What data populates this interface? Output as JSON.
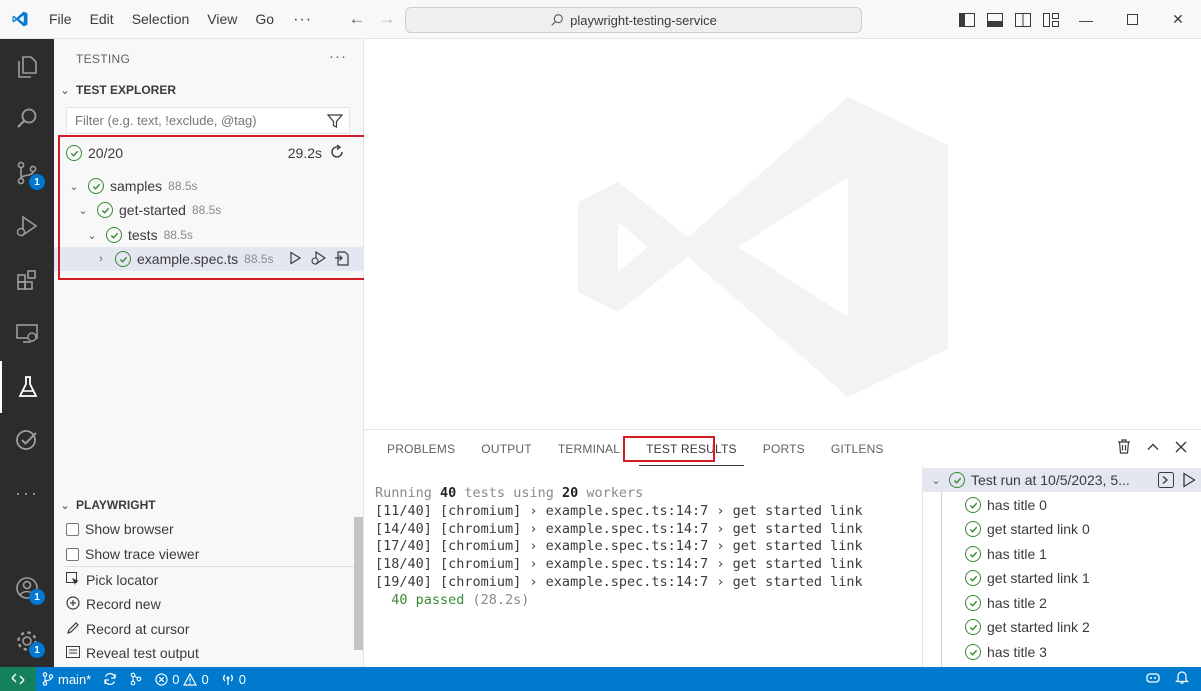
{
  "titlebar": {
    "menu": [
      "File",
      "Edit",
      "Selection",
      "View",
      "Go"
    ],
    "more": "···",
    "search_text": "playwright-testing-service"
  },
  "activity": {
    "source_control_badge": "1",
    "accounts_badge": "1",
    "settings_badge": "1"
  },
  "sidebar": {
    "header": "TESTING",
    "explorer_title": "TEST EXPLORER",
    "filter_placeholder": "Filter (e.g. text, !exclude, @tag)",
    "summary": {
      "count": "20/20",
      "time": "29.2s"
    },
    "tree": [
      {
        "label": "samples",
        "duration": "88.5s"
      },
      {
        "label": "get-started",
        "duration": "88.5s"
      },
      {
        "label": "tests",
        "duration": "88.5s"
      },
      {
        "label": "example.spec.ts",
        "duration": "88.5s"
      }
    ],
    "playwright_title": "PLAYWRIGHT",
    "playwright_items": {
      "show_browser": "Show browser",
      "show_trace_viewer": "Show trace viewer",
      "pick_locator": "Pick locator",
      "record_new": "Record new",
      "record_at_cursor": "Record at cursor",
      "reveal_output": "Reveal test output"
    }
  },
  "panel": {
    "tabs": [
      "PROBLEMS",
      "OUTPUT",
      "TERMINAL",
      "TEST RESULTS",
      "PORTS",
      "GITLENS"
    ],
    "active_tab": "TEST RESULTS",
    "terminal": {
      "running_prefix": "Running ",
      "tests_count": "40",
      "running_mid": " tests using ",
      "workers_count": "20",
      "running_suffix": " workers",
      "lines": [
        "[11/40] [chromium] › example.spec.ts:14:7 › get started link",
        "[14/40] [chromium] › example.spec.ts:14:7 › get started link",
        "[17/40] [chromium] › example.spec.ts:14:7 › get started link",
        "[18/40] [chromium] › example.spec.ts:14:7 › get started link",
        "[19/40] [chromium] › example.spec.ts:14:7 › get started link"
      ],
      "passed": "  40 passed",
      "passed_time": " (28.2s)"
    },
    "results": {
      "run_label": "Test run at 10/5/2023, 5...",
      "items": [
        "has title 0",
        "get started link 0",
        "has title 1",
        "get started link 1",
        "has title 2",
        "get started link 2",
        "has title 3"
      ]
    }
  },
  "statusbar": {
    "branch": "main*",
    "errors": "0",
    "warnings": "0",
    "ports": "0"
  },
  "colors": {
    "accent_blue": "#007acc",
    "pass_green": "#388a34",
    "highlight_red": "#d21b24"
  }
}
